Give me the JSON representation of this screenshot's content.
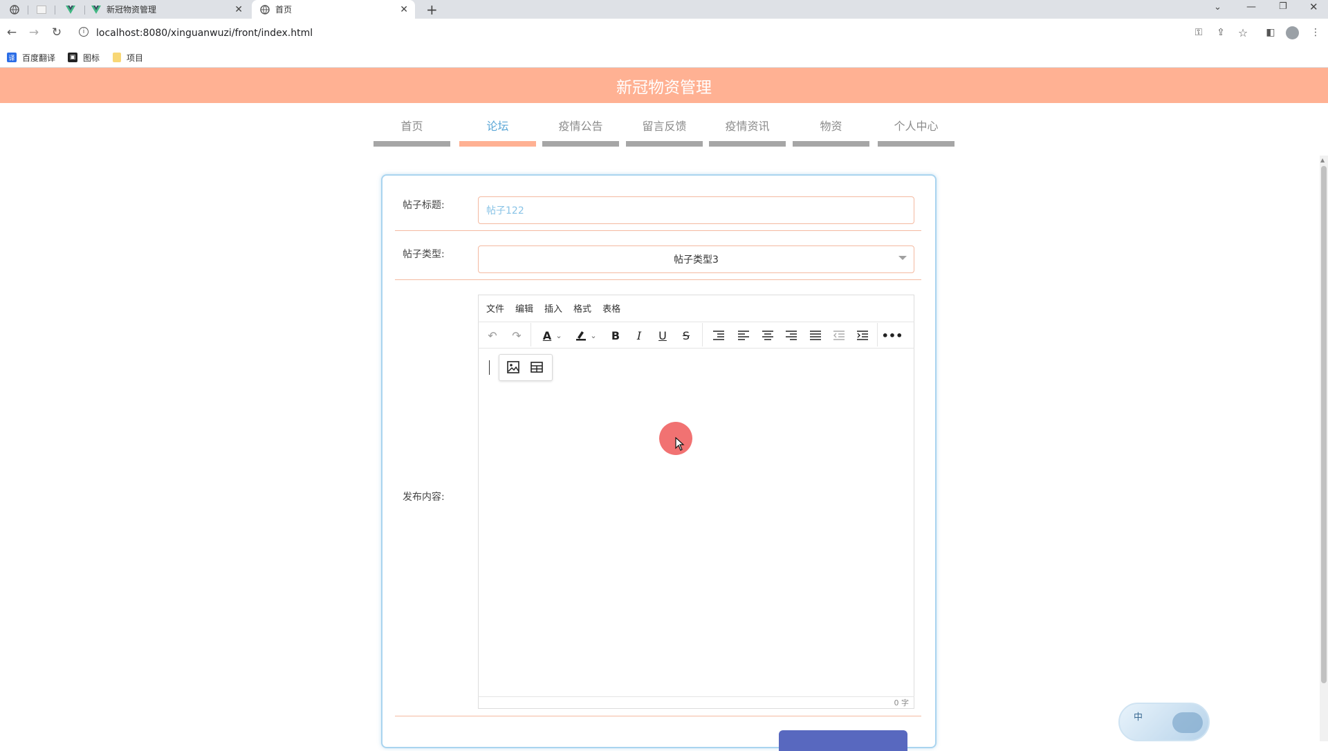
{
  "browser": {
    "tabs": [
      {
        "label": "新冠物资管理"
      },
      {
        "label": "首页"
      }
    ],
    "url": "localhost:8080/xinguanwuzi/front/index.html",
    "bookmarks": [
      {
        "label": "百度翻译",
        "icon": "translate-icon"
      },
      {
        "label": "图标",
        "icon": "image-bookmark-icon"
      },
      {
        "label": "项目",
        "icon": "folder-icon"
      }
    ]
  },
  "site": {
    "title": "新冠物资管理",
    "nav": [
      {
        "label": "首页"
      },
      {
        "label": "论坛",
        "active": true
      },
      {
        "label": "疫情公告"
      },
      {
        "label": "留言反馈"
      },
      {
        "label": "疫情资讯"
      },
      {
        "label": "物资"
      },
      {
        "label": "个人中心"
      }
    ]
  },
  "form": {
    "title_label": "帖子标题:",
    "title_value": "帖子122",
    "type_label": "帖子类型:",
    "type_value": "帖子类型3",
    "content_label": "发布内容:"
  },
  "editor": {
    "menu": [
      "文件",
      "编辑",
      "插入",
      "格式",
      "表格"
    ],
    "word_count": "0 字"
  },
  "ime": {
    "label": "中"
  },
  "colors": {
    "header": "#ffb193",
    "active_nav": "#5aa6d6",
    "card_border": "#a9d4ef",
    "submit": "#5868bf"
  }
}
